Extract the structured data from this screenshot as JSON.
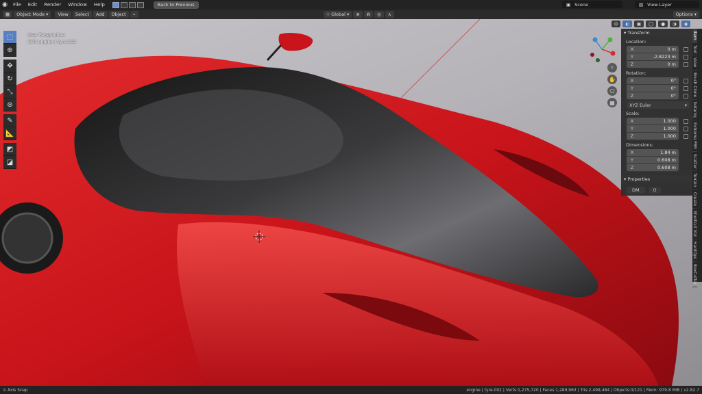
{
  "topbar": {
    "menu": [
      "File",
      "Edit",
      "Render",
      "Window",
      "Help"
    ],
    "back_button": "Back to Previous",
    "scene": "Scene",
    "view_layer": "View Layer"
  },
  "header": {
    "mode": "Object Mode",
    "menus": [
      "View",
      "Select",
      "Add",
      "Object"
    ],
    "orientation": "Global",
    "options": "Options"
  },
  "viewport": {
    "view_name": "User Perspective",
    "collection": "(34) engine | tyre.002"
  },
  "npanel": {
    "transform_title": "Transform",
    "location_label": "Location:",
    "location": [
      {
        "axis": "X",
        "value": "0 m"
      },
      {
        "axis": "Y",
        "value": "-2.8223 m"
      },
      {
        "axis": "Z",
        "value": "0 m"
      }
    ],
    "rotation_label": "Rotation:",
    "rotation": [
      {
        "axis": "X",
        "value": "0°"
      },
      {
        "axis": "Y",
        "value": "0°"
      },
      {
        "axis": "Z",
        "value": "0°"
      }
    ],
    "rotation_mode": "XYZ Euler",
    "scale_label": "Scale:",
    "scale": [
      {
        "axis": "X",
        "value": "1.000"
      },
      {
        "axis": "Y",
        "value": "1.000"
      },
      {
        "axis": "Z",
        "value": "1.000"
      }
    ],
    "dimensions_label": "Dimensions:",
    "dimensions": [
      {
        "axis": "X",
        "value": "1.84 m"
      },
      {
        "axis": "Y",
        "value": "0.608 m"
      },
      {
        "axis": "Z",
        "value": "0.608 m"
      }
    ],
    "properties_title": "Properties",
    "prop_name": "DM",
    "prop_value": "()"
  },
  "tabs": [
    "Item",
    "Tool",
    "View",
    "Brush Clone",
    "botaniq",
    "Extreme PBR",
    "Scatter",
    "Terrain",
    "Create",
    "Shortcut VUr",
    "HardOps",
    "BoxCutter"
  ],
  "status": {
    "left": "Axis Snap",
    "right": "engine | tyre.002 | Verts:1,275,720 | Faces:1,289,963 | Tris:2,499,484 | Objects:0/121 | Mem: 979.8 MiB | v2.82.7"
  },
  "colors": {
    "accent": "#5680c2",
    "car_red": "#c8141a",
    "header_bg": "#232323"
  }
}
